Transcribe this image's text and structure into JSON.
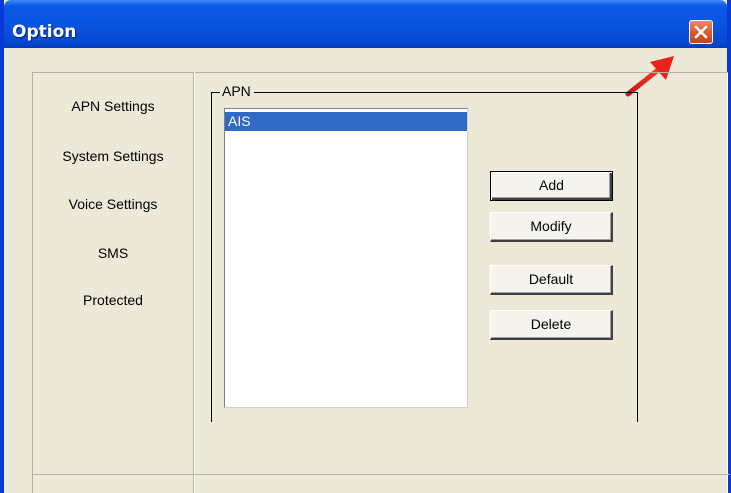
{
  "window": {
    "title": "Option",
    "close_label": "×"
  },
  "sidebar": {
    "items": [
      {
        "label": "APN Settings"
      },
      {
        "label": "System Settings"
      },
      {
        "label": "Voice Settings"
      },
      {
        "label": "SMS"
      },
      {
        "label": "Protected"
      }
    ]
  },
  "apn": {
    "group_label": "APN",
    "list": [
      {
        "label": "AIS",
        "selected": true
      }
    ],
    "buttons": {
      "add": "Add",
      "modify": "Modify",
      "default": "Default",
      "delete": "Delete"
    }
  },
  "colors": {
    "titlebar": "#0854e0",
    "selection": "#316ac5",
    "annotation_arrow": "#e8231a",
    "dialog_bg": "#ece9d8"
  }
}
